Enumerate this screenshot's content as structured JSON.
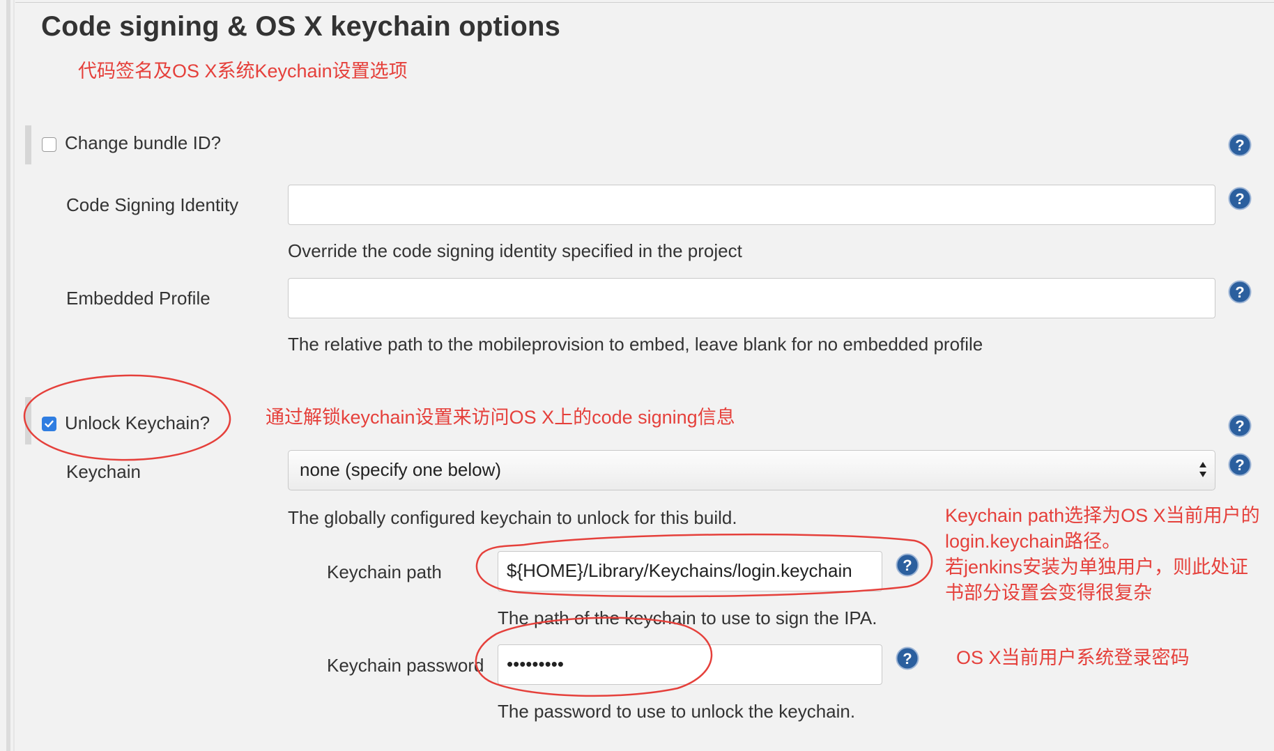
{
  "section": {
    "title": "Code signing & OS X keychain options"
  },
  "annotations": {
    "section_cn": "代码签名及OS X系统Keychain设置选项",
    "unlock_cn": "通过解锁keychain设置来访问OS X上的code signing信息",
    "path_cn_line1": "Keychain path选择为OS X当前用户的",
    "path_cn_line2": "login.keychain路径。",
    "path_cn_line3": "若jenkins安装为单独用户，则此处证",
    "path_cn_line4": "书部分设置会变得很复杂",
    "password_cn": "OS X当前用户系统登录密码"
  },
  "form": {
    "change_bundle_id": {
      "label": "Change bundle ID?",
      "checked": false
    },
    "code_signing_identity": {
      "label": "Code Signing Identity",
      "value": "",
      "description": "Override the code signing identity specified in the project"
    },
    "embedded_profile": {
      "label": "Embedded Profile",
      "value": "",
      "description": "The relative path to the mobileprovision to embed, leave blank for no embedded profile"
    },
    "unlock_keychain": {
      "label": "Unlock Keychain?",
      "checked": true
    },
    "keychain": {
      "label": "Keychain",
      "selected": "none (specify one below)",
      "description": "The globally configured keychain to unlock for this build."
    },
    "keychain_path": {
      "label": "Keychain path",
      "value": "${HOME}/Library/Keychains/login.keychain",
      "description": "The path of the keychain to use to sign the IPA."
    },
    "keychain_password": {
      "label": "Keychain password",
      "value": "•••••••••",
      "description": "The password to use to unlock the keychain."
    }
  },
  "icons": {
    "help": "question-mark-help-icon",
    "checkmark": "checkmark-icon",
    "select_arrows": "up-down-arrows-icon"
  },
  "colors": {
    "annotation_red": "#e5403b",
    "checkbox_blue": "#2f7de1",
    "help_blue": "#2b5f9e",
    "background": "#f2f2f2"
  }
}
